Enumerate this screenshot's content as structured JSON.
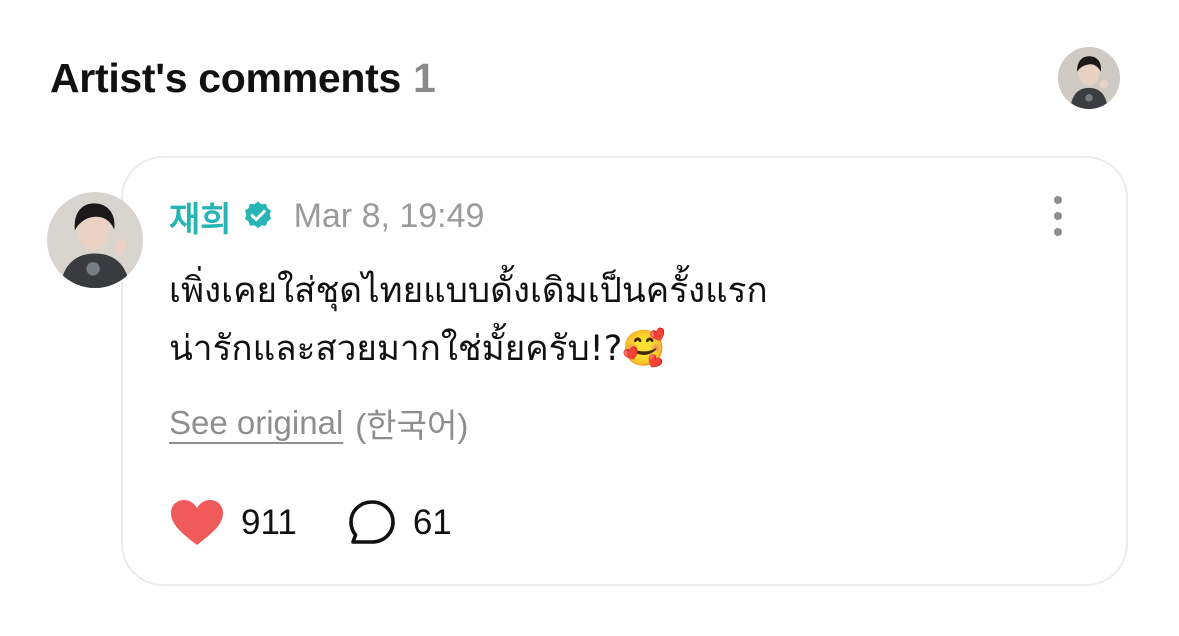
{
  "header": {
    "title": "Artist's comments",
    "count": "1"
  },
  "comment": {
    "author": "재희",
    "timestamp": "Mar 8, 19:49",
    "body_lines": [
      "เพิ่งเคยใส่ชุดไทยแบบดั้งเดิมเป็นครั้งแรก",
      "น่ารักและสวยมากใช่มั้ยครับ!?🥰"
    ],
    "see_original_label": "See original",
    "original_language": "(한국어)",
    "likes": "911",
    "replies": "61"
  },
  "colors": {
    "author": "#27b4b4",
    "heart": "#ef5a5a",
    "muted": "#8e8e8e",
    "card_border": "#ececec"
  },
  "icons": {
    "verified": "verified-badge-icon",
    "more": "more-vertical-icon",
    "like": "heart-icon",
    "reply": "comment-bubble-icon"
  }
}
